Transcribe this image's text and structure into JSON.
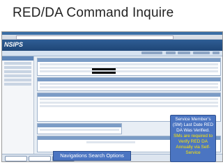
{
  "slide": {
    "title": "RED/DA Command Inquire"
  },
  "app": {
    "logo": "NSIPS"
  },
  "callout": {
    "lines": [
      "Service Member’s",
      "(SM) Last Date RED",
      "DA Was Verified.",
      "SMs are required to",
      "Verify RED DA",
      "Annually via Self-",
      "Service"
    ]
  },
  "navigation": {
    "label": "Navigations Search Options"
  },
  "colors": {
    "callout_bg": "#4b75c2",
    "callout_highlight": "#ffe600",
    "banner": "#2e5d94"
  }
}
